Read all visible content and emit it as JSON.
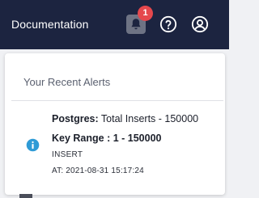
{
  "header": {
    "documentation_label": "Documentation",
    "notification_count": "1",
    "icons": [
      "bell-icon",
      "help-circle-icon",
      "user-circle-icon"
    ],
    "background_color": "#1c2440"
  },
  "alerts_panel": {
    "title": "Your Recent Alerts",
    "alerts": [
      {
        "icon": "info-icon",
        "source": "Postgres:",
        "summary": " Total Inserts - 150000",
        "key_range": "Key Range : 1 - 150000",
        "operation": "INSERT",
        "time": "AT: 2021-08-31 15:17:24"
      }
    ]
  },
  "colors": {
    "badge": "#e5484d",
    "info": "#2f9bd6"
  }
}
